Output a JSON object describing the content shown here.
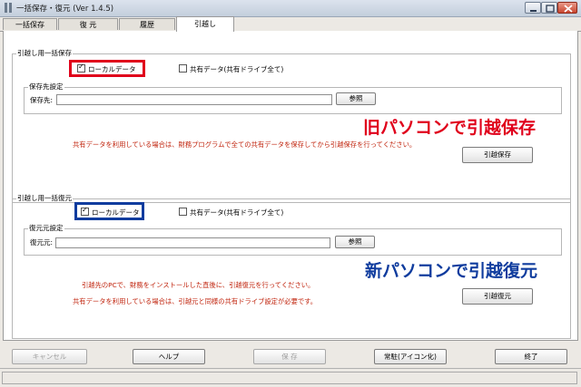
{
  "window": {
    "title": "一括保存・復元 (Ver 1.4.5)"
  },
  "tabs": [
    {
      "label": "一括保存"
    },
    {
      "label": "復 元"
    },
    {
      "label": "履歴"
    },
    {
      "label": "引越し"
    }
  ],
  "active_tab": "引越し",
  "save_section": {
    "legend": "引越し用一括保存",
    "local_data": {
      "label": "ローカルデータ",
      "checked": true
    },
    "shared_data": {
      "label": "共有データ(共有ドライブ全て)",
      "checked": false
    },
    "dest_group": {
      "legend": "保存先設定",
      "field_label": "保存先:",
      "field_value": "",
      "browse_label": "参照"
    },
    "overlay_text": "旧パソコンで引越保存",
    "note": "共有データを利用している場合は、財務プログラムで全ての共有データを保存してから引越保存を行ってください。",
    "action_label": "引越保存"
  },
  "restore_section": {
    "legend": "引越し用一括復元",
    "local_data": {
      "label": "ローカルデータ",
      "checked": true
    },
    "shared_data": {
      "label": "共有データ(共有ドライブ全て)",
      "checked": false
    },
    "src_group": {
      "legend": "復元元設定",
      "field_label": "復元元:",
      "field_value": "",
      "browse_label": "参照"
    },
    "overlay_text": "新パソコンで引越復元",
    "note1": "引越先のPCで、財務をインストールした直後に、引越復元を行ってください。",
    "note2": "共有データを利用している場合は、引越元と同様の共有ドライブ設定が必要です。",
    "action_label": "引越復元"
  },
  "footer": {
    "cancel_label": "キャンセル",
    "help_label": "ヘルプ",
    "save_label": "保 存",
    "tray_label": "常駐(アイコン化)",
    "exit_label": "終了"
  },
  "colors": {
    "highlight_red": "#e0001b",
    "highlight_blue": "#0f3c9e",
    "note_red": "#c0230c"
  }
}
